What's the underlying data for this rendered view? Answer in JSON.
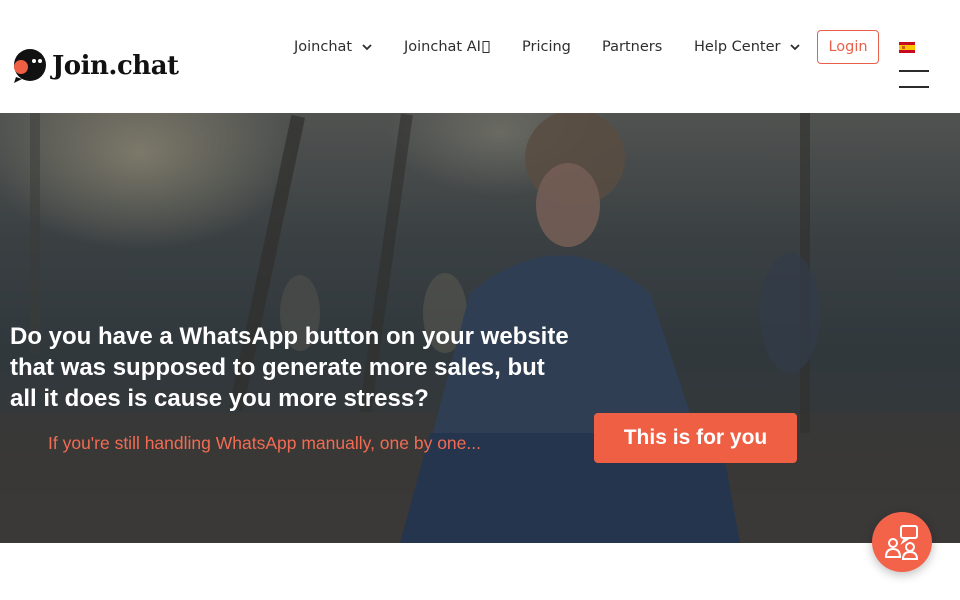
{
  "brand": {
    "name": "Join.chat",
    "accent": "#ef5f44"
  },
  "nav": {
    "items": [
      {
        "label": "Joinchat",
        "has_dropdown": true
      },
      {
        "label": "Joinchat AI",
        "has_dropdown": false
      },
      {
        "label": "Pricing",
        "has_dropdown": false
      },
      {
        "label": "Partners",
        "has_dropdown": false
      },
      {
        "label": "Help Center",
        "has_dropdown": true
      }
    ],
    "login_label": "Login",
    "language_flag": "es-flag-icon",
    "menu_icon": "hamburger-icon"
  },
  "hero": {
    "headline": "Do you have a WhatsApp button on your website that was supposed to generate more sales, but all it does is cause you more stress?",
    "subline": "If you're still handling WhatsApp manually, one by one...",
    "cta_label": "This is for you"
  },
  "floating": {
    "icon": "chat-support-icon"
  }
}
